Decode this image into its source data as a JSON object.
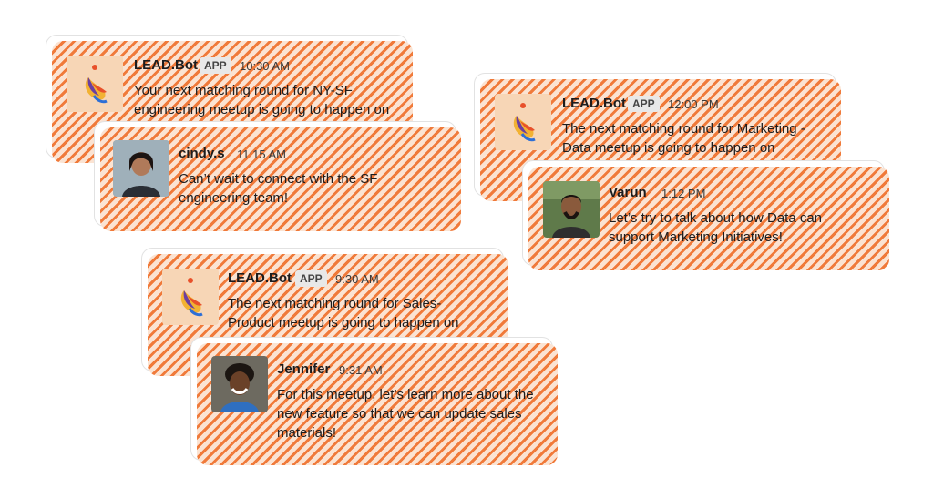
{
  "threads": [
    {
      "bot": {
        "name": "LEAD.Bot",
        "badge": "APP",
        "time": "10:30 AM",
        "text": "Your next matching round for NY-SF engineering meetup is going to happen on"
      },
      "reply": {
        "name": "cindy.s",
        "time": "11:15 AM",
        "text": "Can’t wait to connect with the SF engineering team!"
      }
    },
    {
      "bot": {
        "name": "LEAD.Bot",
        "badge": "APP",
        "time": "12:00 PM",
        "text": "The next matching round for Marketing - Data meetup is going to happen on"
      },
      "reply": {
        "name": "Varun",
        "time": "1:12 PM",
        "text": "Let’s try to talk about how Data can support Marketing Initiatives!"
      }
    },
    {
      "bot": {
        "name": "LEAD.Bot",
        "badge": "APP",
        "time": "9:30 AM",
        "text": "The next matching round for Sales-Product meetup is going to happen on"
      },
      "reply": {
        "name": "Jennifer",
        "time": "9:31 AM",
        "text": "For this meetup, let’s learn more about the new feature so that we can update sales materials!"
      }
    }
  ],
  "colors": {
    "stripe": "#f07a3a",
    "stripe_light": "#fbe3d2",
    "bot_bg": "#f7d6b6"
  },
  "icons": {
    "bot_avatar": "lead-bot-logo-icon",
    "user_avatar": "user-photo"
  }
}
